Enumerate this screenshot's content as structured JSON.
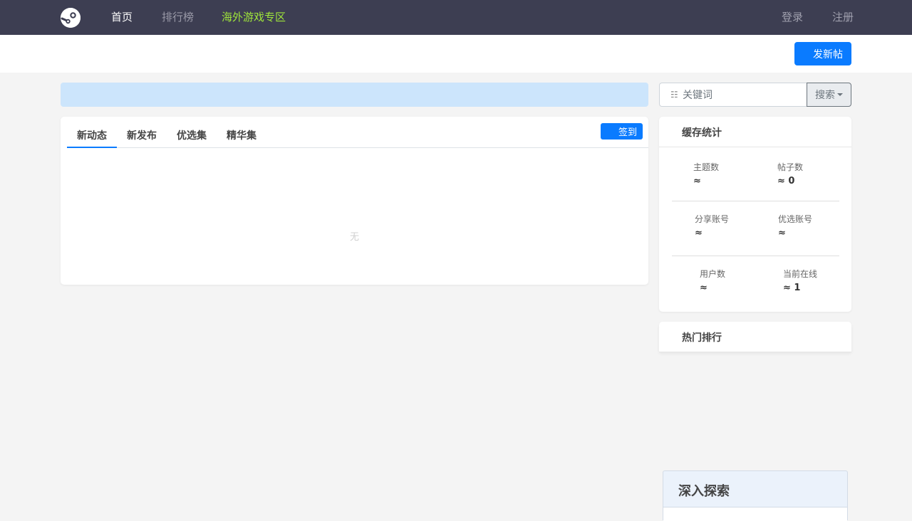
{
  "nav": {
    "logo_icon": "steam-logo-icon",
    "items": [
      {
        "label": "首页",
        "color": "#ffffff"
      },
      {
        "label": "排行榜",
        "color": "#9a9aa8"
      },
      {
        "label": "海外游戏专区",
        "color": "#9fe53a"
      }
    ],
    "login": "登录",
    "register": "注册"
  },
  "subheader": {
    "post_button": "发新帖"
  },
  "search": {
    "icon": "grid-icon",
    "placeholder": "关键词",
    "button": "搜索"
  },
  "main": {
    "tabs": [
      "新动态",
      "新发布",
      "优选集",
      "精华集"
    ],
    "checkin_button": "签到",
    "empty_text": "无"
  },
  "stats": {
    "title": "缓存统计",
    "items": [
      {
        "label": "主题数",
        "value": "≈"
      },
      {
        "label": "帖子数",
        "value": "≈ 0"
      },
      {
        "label": "分享账号",
        "value": "≈"
      },
      {
        "label": "优选账号",
        "value": "≈"
      },
      {
        "label": "用户数",
        "value": "≈"
      },
      {
        "label": "当前在线",
        "value": "≈ 1"
      }
    ]
  },
  "hot": {
    "title": "热门排行"
  },
  "explore": {
    "title": "深入探索"
  },
  "colors": {
    "accent": "#0a7bff",
    "nav_bg": "#3d3e52",
    "overseas": "#9fe53a"
  }
}
